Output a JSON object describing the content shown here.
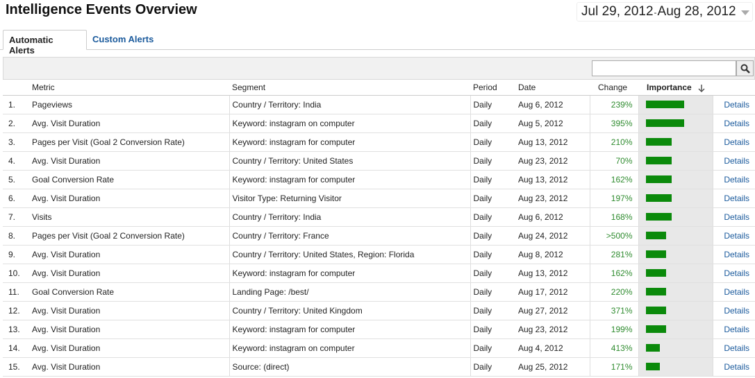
{
  "page": {
    "title": "Intelligence Events Overview",
    "date_start": "Jul 29, 2012",
    "date_sep": "-",
    "date_end": "Aug 28, 2012"
  },
  "tabs": [
    {
      "label": "Automatic Alerts",
      "active": true
    },
    {
      "label": "Custom Alerts",
      "active": false
    }
  ],
  "search": {
    "value": ""
  },
  "columns": {
    "metric": "Metric",
    "segment": "Segment",
    "period": "Period",
    "date": "Date",
    "change": "Change",
    "importance": "Importance"
  },
  "colors": {
    "bar": "#0b8a0b",
    "change": "#2e8b2e",
    "link": "#1a5a9c"
  },
  "rows": [
    {
      "num": "1.",
      "metric": "Pageviews",
      "segment": "Country / Territory: India",
      "period": "Daily",
      "date": "Aug 6, 2012",
      "change": "239%",
      "importance": 0.5,
      "details": "Details"
    },
    {
      "num": "2.",
      "metric": "Avg. Visit Duration",
      "segment": "Keyword: instagram on computer",
      "period": "Daily",
      "date": "Aug 5, 2012",
      "change": "395%",
      "importance": 0.5,
      "details": "Details"
    },
    {
      "num": "3.",
      "metric": "Pages per Visit (Goal 2 Conversion Rate)",
      "segment": "Keyword: instagram for computer",
      "period": "Daily",
      "date": "Aug 13, 2012",
      "change": "210%",
      "importance": 0.34,
      "details": "Details"
    },
    {
      "num": "4.",
      "metric": "Avg. Visit Duration",
      "segment": "Country / Territory: United States",
      "period": "Daily",
      "date": "Aug 23, 2012",
      "change": "70%",
      "importance": 0.34,
      "details": "Details"
    },
    {
      "num": "5.",
      "metric": "Goal Conversion Rate",
      "segment": "Keyword: instagram for computer",
      "period": "Daily",
      "date": "Aug 13, 2012",
      "change": "162%",
      "importance": 0.34,
      "details": "Details"
    },
    {
      "num": "6.",
      "metric": "Avg. Visit Duration",
      "segment": "Visitor Type: Returning Visitor",
      "period": "Daily",
      "date": "Aug 23, 2012",
      "change": "197%",
      "importance": 0.34,
      "details": "Details"
    },
    {
      "num": "7.",
      "metric": "Visits",
      "segment": "Country / Territory: India",
      "period": "Daily",
      "date": "Aug 6, 2012",
      "change": "168%",
      "importance": 0.34,
      "details": "Details"
    },
    {
      "num": "8.",
      "metric": "Pages per Visit (Goal 2 Conversion Rate)",
      "segment": "Country / Territory: France",
      "period": "Daily",
      "date": "Aug 24, 2012",
      "change": ">500%",
      "importance": 0.26,
      "details": "Details"
    },
    {
      "num": "9.",
      "metric": "Avg. Visit Duration",
      "segment": "Country / Territory: United States, Region: Florida",
      "period": "Daily",
      "date": "Aug 8, 2012",
      "change": "281%",
      "importance": 0.26,
      "details": "Details"
    },
    {
      "num": "10.",
      "metric": "Avg. Visit Duration",
      "segment": "Keyword: instagram for computer",
      "period": "Daily",
      "date": "Aug 13, 2012",
      "change": "162%",
      "importance": 0.26,
      "details": "Details"
    },
    {
      "num": "11.",
      "metric": "Goal Conversion Rate",
      "segment": "Landing Page: /best/",
      "period": "Daily",
      "date": "Aug 17, 2012",
      "change": "220%",
      "importance": 0.26,
      "details": "Details"
    },
    {
      "num": "12.",
      "metric": "Avg. Visit Duration",
      "segment": "Country / Territory: United Kingdom",
      "period": "Daily",
      "date": "Aug 27, 2012",
      "change": "371%",
      "importance": 0.26,
      "details": "Details"
    },
    {
      "num": "13.",
      "metric": "Avg. Visit Duration",
      "segment": "Keyword: instagram for computer",
      "period": "Daily",
      "date": "Aug 23, 2012",
      "change": "199%",
      "importance": 0.26,
      "details": "Details"
    },
    {
      "num": "14.",
      "metric": "Avg. Visit Duration",
      "segment": "Keyword: instagram on computer",
      "period": "Daily",
      "date": "Aug 4, 2012",
      "change": "413%",
      "importance": 0.18,
      "details": "Details"
    },
    {
      "num": "15.",
      "metric": "Avg. Visit Duration",
      "segment": "Source: (direct)",
      "period": "Daily",
      "date": "Aug 25, 2012",
      "change": "171%",
      "importance": 0.18,
      "details": "Details"
    }
  ]
}
